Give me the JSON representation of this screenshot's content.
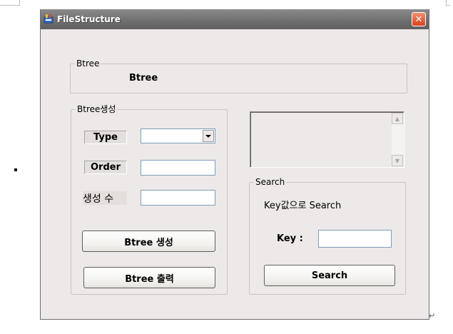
{
  "window": {
    "title": "FileStructure",
    "close_glyph": "✕"
  },
  "btree_display": {
    "legend": "Btree",
    "text": "Btree"
  },
  "create_group": {
    "legend": "Btree생성",
    "type_label": "Type",
    "type_value": "",
    "order_label": "Order",
    "order_value": "",
    "count_label": "생성 수",
    "count_value": "",
    "create_button": "Btree 생성",
    "print_button": "Btree 출력"
  },
  "output_list": {
    "items": [],
    "scroll_up": "▲",
    "scroll_down": "▼"
  },
  "search_group": {
    "legend": "Search",
    "description": "Key값으로 Search",
    "key_label": "Key :",
    "key_value": "",
    "search_button": "Search"
  },
  "icons": {
    "app": "app-icon",
    "close": "close-icon",
    "dropdown": "chevron-down-icon"
  },
  "colors": {
    "titlebar": "#6e6e6e",
    "close": "#d9441c",
    "client_bg": "#ece9e8",
    "input_border": "#7f9db9"
  }
}
